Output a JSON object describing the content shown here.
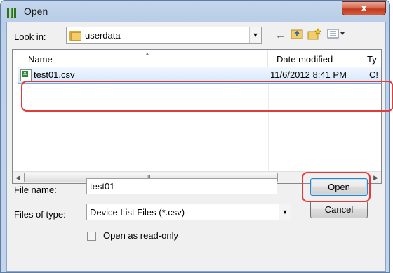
{
  "window": {
    "title": "Open",
    "close_glyph": "x"
  },
  "toolbar": {
    "lookin_label": "Look in:",
    "lookin_value": "userdata",
    "icons": [
      "back-arrow-icon",
      "up-folder-icon",
      "new-folder-icon",
      "view-menu-icon"
    ]
  },
  "list": {
    "columns": [
      "Name",
      "Date modified",
      "Ty"
    ],
    "rows": [
      {
        "name": "test01.csv",
        "date": "11/6/2012 8:41 PM",
        "type": "C!"
      }
    ],
    "scroll_grip": "III"
  },
  "form": {
    "filename_label": "File name:",
    "filename_value": "test01",
    "filetype_label": "Files of type:",
    "filetype_value": "Device List Files (*.csv)",
    "readonly_label": "Open as read-only"
  },
  "buttons": {
    "open": "Open",
    "cancel": "Cancel"
  },
  "colors": {
    "highlight": "#e23b3b",
    "selection": "#d5e7fb",
    "accent": "#3c7fb1"
  }
}
